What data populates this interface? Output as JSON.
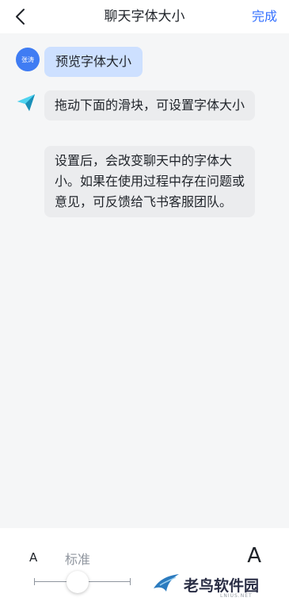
{
  "header": {
    "title": "聊天字体大小",
    "done_label": "完成"
  },
  "chat": {
    "user_avatar_text": "张涛",
    "user_message": "预览字体大小",
    "bot_messages": [
      "拖动下面的滑块，可设置字体大小",
      "设置后，会改变聊天中的字体大小。如果在使用过程中存在问题或意见，可反馈给飞书客服团队。"
    ]
  },
  "font_size": {
    "small_a": "A",
    "large_a": "A",
    "current_label": "标准",
    "slider_level_fraction": 0.45
  },
  "watermark": {
    "text": "老鸟软件园",
    "sub": "LNIUS.NET"
  },
  "colors": {
    "accent": "#3370ff",
    "user_bubble": "#cde0ff",
    "bot_bubble": "#ebecee",
    "background": "#f5f6f7"
  },
  "icons": {
    "back": "chevron-left-icon",
    "bot_avatar": "paper-plane-icon"
  }
}
